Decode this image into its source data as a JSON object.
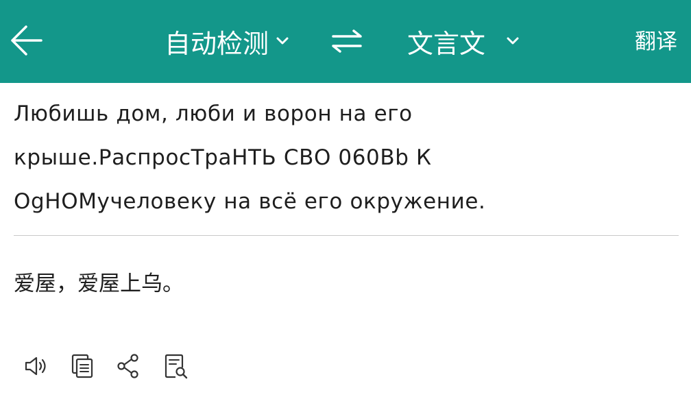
{
  "header": {
    "back_icon": "arrow-left-icon",
    "source_language": "自动检测",
    "target_language": "文言文",
    "swap_icon": "swap-arrows-icon",
    "translate_label": "翻译",
    "bar_color": "#13978a"
  },
  "input": {
    "lines": [
      "Любишь дом, люби и ворон на его",
      "крыше.РаспросТраНТЬ СВО 060Вb К",
      "OgHOMучеловеку на всё его окружение."
    ]
  },
  "output": {
    "text": "爱屋，爱屋上乌。"
  },
  "actions": [
    {
      "name": "speaker-icon"
    },
    {
      "name": "copy-icon"
    },
    {
      "name": "share-icon"
    },
    {
      "name": "dictionary-search-icon"
    }
  ]
}
